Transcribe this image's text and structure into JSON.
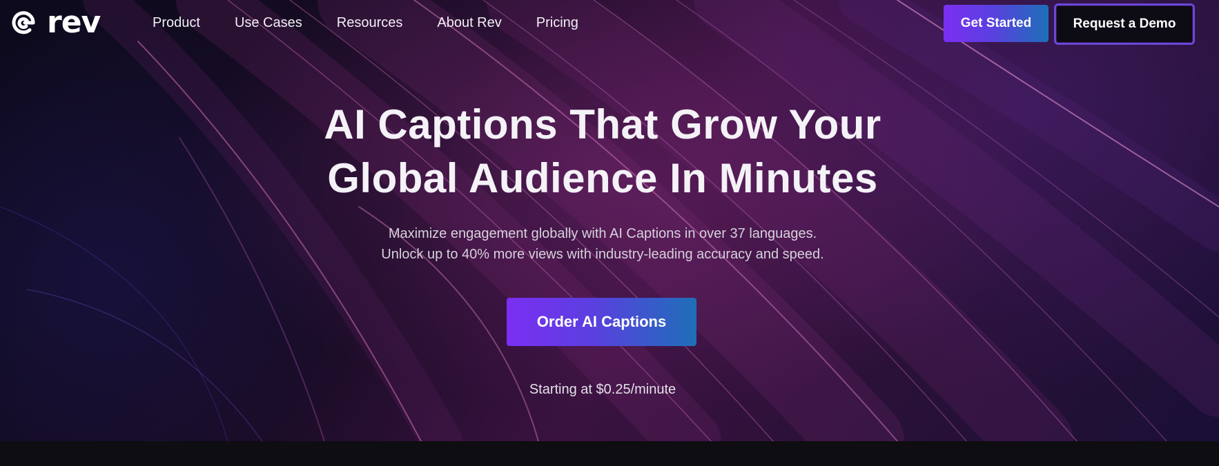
{
  "brand": {
    "logo_text": "rev",
    "logo_icon": "rev-logo-icon"
  },
  "nav": {
    "items": [
      {
        "label": "Product"
      },
      {
        "label": "Use Cases"
      },
      {
        "label": "Resources"
      },
      {
        "label": "About Rev"
      },
      {
        "label": "Pricing"
      }
    ],
    "get_started_label": "Get Started",
    "demo_label": "Request a Demo"
  },
  "hero": {
    "headline_line1": "AI Captions That Grow Your",
    "headline_line2": "Global Audience In Minutes",
    "subtext_line1": "Maximize engagement globally with AI Captions in over 37 languages.",
    "subtext_line2": "Unlock up to 40% more views with industry-leading accuracy and speed.",
    "cta_label": "Order AI Captions",
    "pricing_note": "Starting at $0.25/minute"
  },
  "colors": {
    "accent_start": "#7b2ff2",
    "accent_end": "#1e6fb8",
    "background": "#0d0b12"
  }
}
